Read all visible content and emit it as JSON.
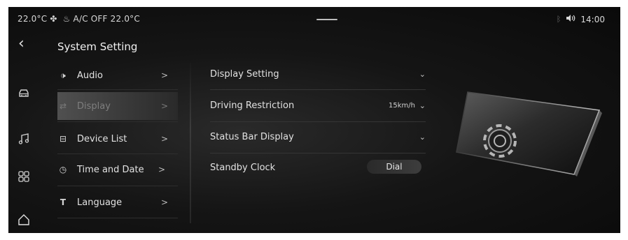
{
  "status_bar": {
    "left_temp": "22.0°C",
    "ac_status": "A/C OFF",
    "right_temp": "22.0°C",
    "time": "14:00",
    "icons": [
      "fan-icon",
      "seat-heat-icon",
      "bluetooth-icon",
      "volume-icon"
    ]
  },
  "header": {
    "title": "System Setting"
  },
  "menu": {
    "items": [
      {
        "label": "Audio",
        "icon": "speaker-icon"
      },
      {
        "label": "Display",
        "icon": "sliders-icon",
        "active": true
      },
      {
        "label": "Device List",
        "icon": "device-icon"
      },
      {
        "label": "Time and Date",
        "icon": "clock-icon"
      },
      {
        "label": "Language",
        "icon": "text-icon"
      }
    ]
  },
  "settings": {
    "display_setting": {
      "label": "Display Setting"
    },
    "driving_restriction": {
      "label": "Driving Restriction",
      "value": "15km/h"
    },
    "status_bar_display": {
      "label": "Status Bar Display"
    },
    "standby_clock": {
      "label": "Standby Clock",
      "value": "Dial"
    }
  },
  "rail": {
    "icons": [
      "back-icon",
      "car-icon",
      "music-icon",
      "apps-icon",
      "home-icon"
    ]
  },
  "colors": {
    "background": "#0f0f0f",
    "active_item": "#4a4a4a",
    "text": "#e6e6e6"
  }
}
